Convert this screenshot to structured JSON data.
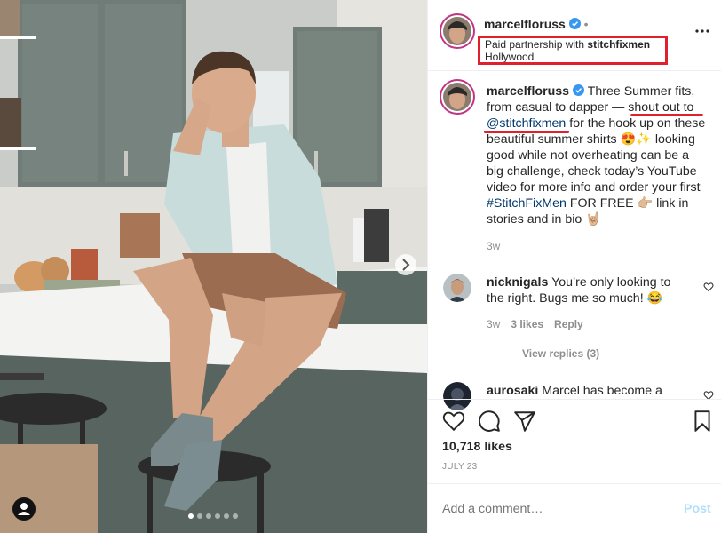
{
  "post": {
    "username": "marcelfloruss",
    "paid_partnership_prefix": "Paid partnership with ",
    "partner": "stitchfixmen",
    "location": "Hollywood",
    "more_icon": "ellipsis-icon"
  },
  "caption": {
    "username": "marcelfloruss",
    "text_1": " Three Summer fits, from casual to dapper — ",
    "text_underlined": "shout out to",
    "mention": "@stitchfixmen",
    "text_2": " for the hook up on these beautiful summer shirts 😍✨ looking good while not overheating can be a big challenge, check today’s YouTube video for more info and order your first ",
    "hashtag": "#StitchFixMen",
    "text_3": " FOR FREE 👉🏼 link in stories and in bio 🤘🏼",
    "time": "3w"
  },
  "comments": [
    {
      "username": "nicknigals",
      "text": " You’re only looking to the right. Bugs me so much! 😂",
      "time": "3w",
      "likes": "3 likes",
      "reply": "Reply",
      "view_replies": "View replies (3)"
    },
    {
      "username": "aurosaki",
      "text": " Marcel has become a"
    }
  ],
  "actions": {
    "likes": "10,718 likes",
    "date": "JULY 23",
    "icons": [
      "heart-icon",
      "comment-icon",
      "share-icon",
      "bookmark-icon"
    ]
  },
  "add_comment": {
    "placeholder": "Add a comment…",
    "post_label": "Post"
  },
  "carousel": {
    "count": 6,
    "active": 1
  },
  "colors": {
    "accent": "#0095f6",
    "verified": "#3897f0",
    "annotation": "#e0212b",
    "link": "#00376b"
  }
}
